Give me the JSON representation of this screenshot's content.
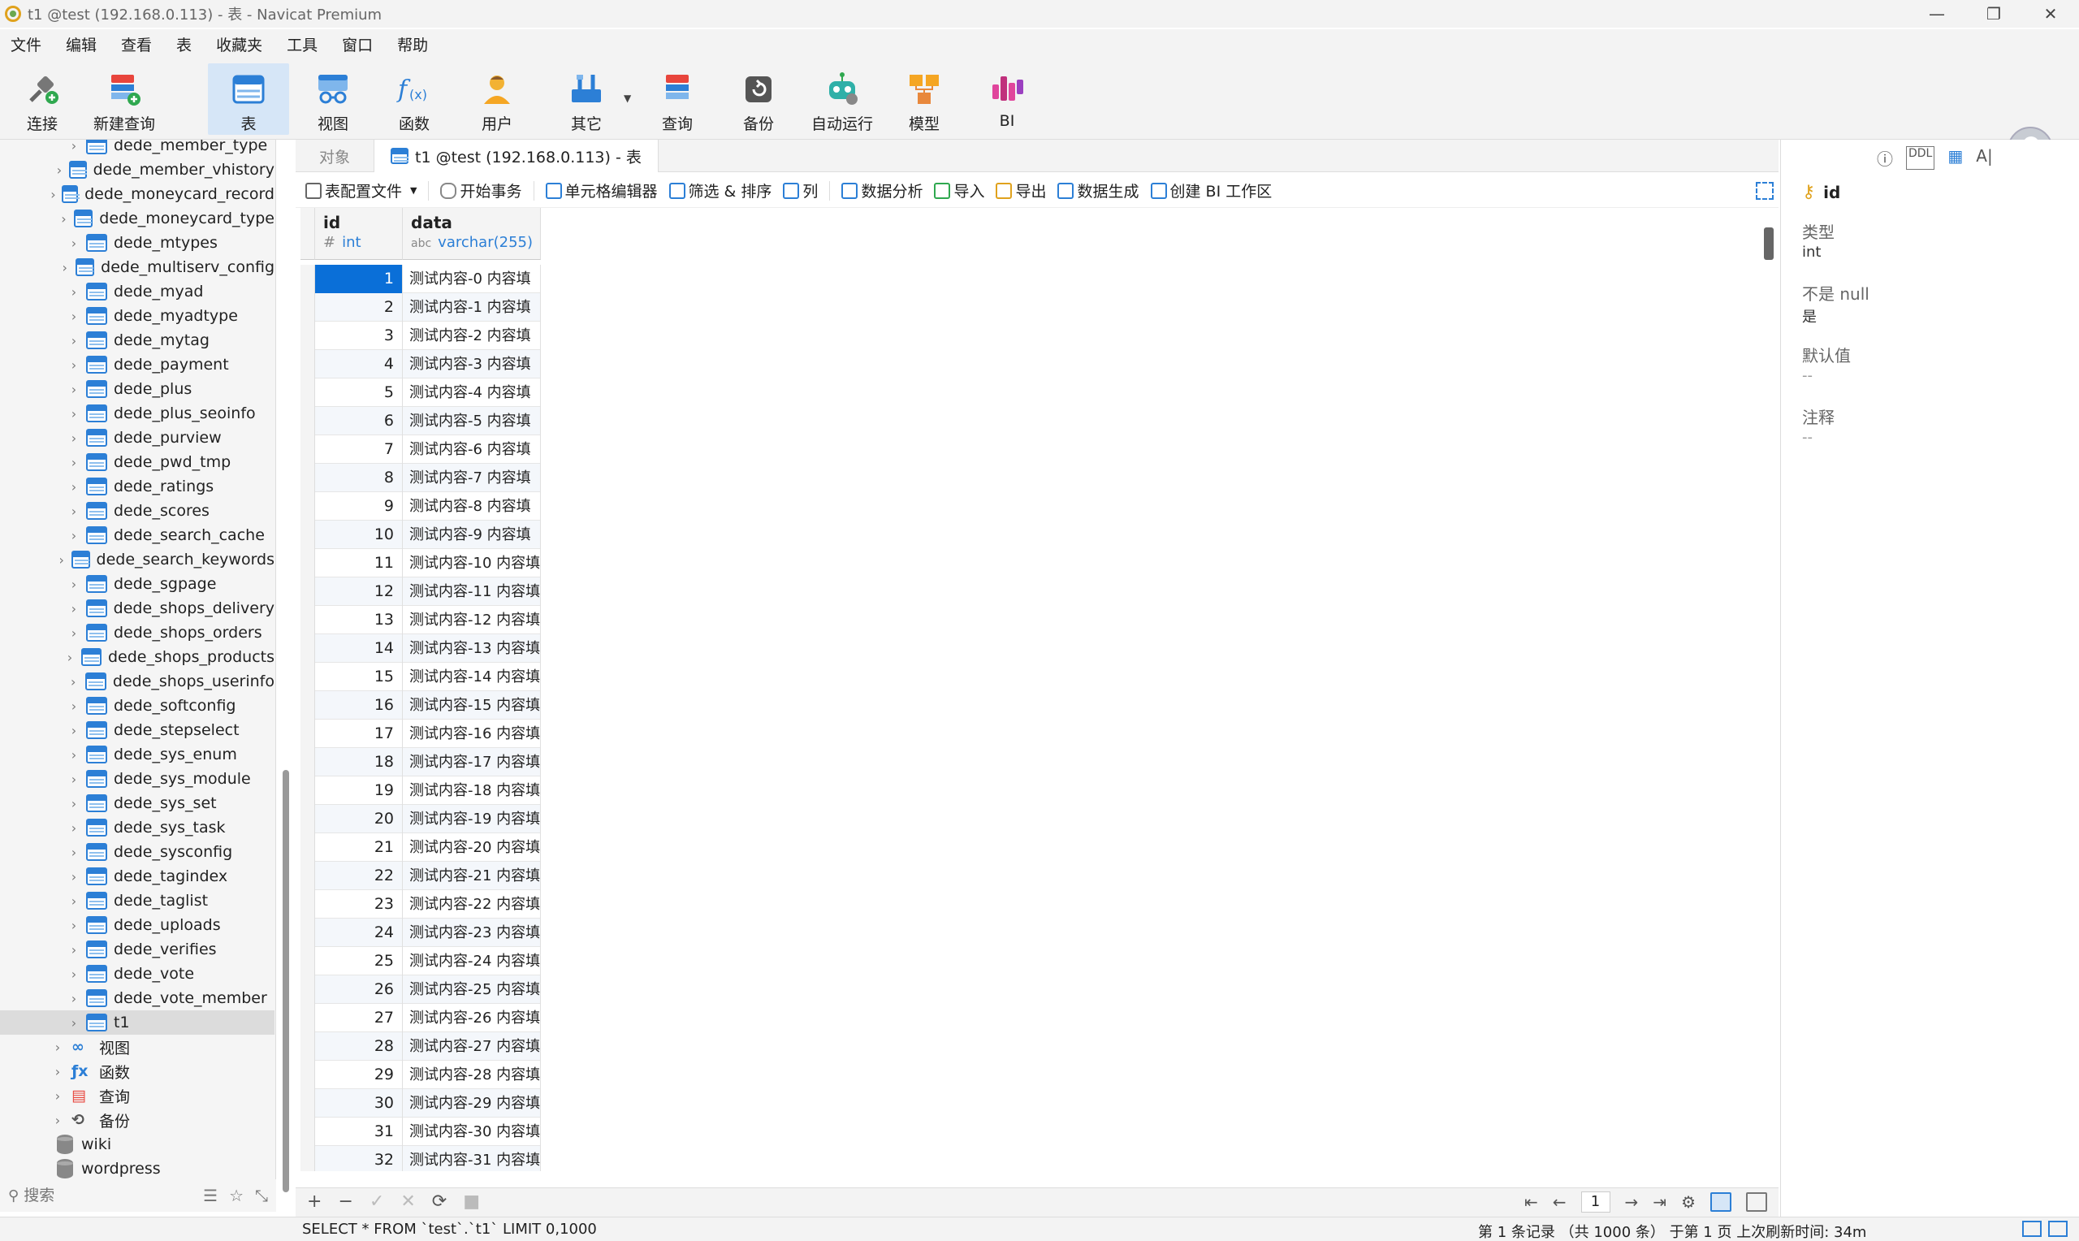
{
  "window": {
    "title": "t1 @test (192.168.0.113) - 表 - Navicat Premium",
    "controls": [
      "—",
      "❐",
      "✕"
    ]
  },
  "menu": [
    "文件",
    "编辑",
    "查看",
    "表",
    "收藏夹",
    "工具",
    "窗口",
    "帮助"
  ],
  "toolbar": {
    "connect": "连接",
    "new_query": "新建查询",
    "table": "表",
    "view": "视图",
    "function": "函数",
    "user": "用户",
    "other": "其它",
    "query": "查询",
    "backup": "备份",
    "automation": "自动运行",
    "model": "模型",
    "bi": "BI"
  },
  "sidebar": {
    "items": [
      "dede_member_type",
      "dede_member_vhistory",
      "dede_moneycard_record",
      "dede_moneycard_type",
      "dede_mtypes",
      "dede_multiserv_config",
      "dede_myad",
      "dede_myadtype",
      "dede_mytag",
      "dede_payment",
      "dede_plus",
      "dede_plus_seoinfo",
      "dede_purview",
      "dede_pwd_tmp",
      "dede_ratings",
      "dede_scores",
      "dede_search_cache",
      "dede_search_keywords",
      "dede_sgpage",
      "dede_shops_delivery",
      "dede_shops_orders",
      "dede_shops_products",
      "dede_shops_userinfo",
      "dede_softconfig",
      "dede_stepselect",
      "dede_sys_enum",
      "dede_sys_module",
      "dede_sys_set",
      "dede_sys_task",
      "dede_sysconfig",
      "dede_tagindex",
      "dede_taglist",
      "dede_uploads",
      "dede_verifies",
      "dede_vote",
      "dede_vote_member",
      "t1"
    ],
    "groups": [
      "视图",
      "函数",
      "查询",
      "备份"
    ],
    "databases": [
      "wiki",
      "wordpress"
    ],
    "search_placeholder": "搜索"
  },
  "tabs": {
    "objects": "对象",
    "active": "t1 @test (192.168.0.113) - 表"
  },
  "data_toolbar": {
    "config": "表配置文件",
    "begin_tx": "开始事务",
    "cell_editor": "单元格编辑器",
    "filter_sort": "筛选 & 排序",
    "columns": "列",
    "analysis": "数据分析",
    "import": "导入",
    "export": "导出",
    "generate": "数据生成",
    "create_bi": "创建 BI 工作区"
  },
  "grid": {
    "columns": [
      {
        "name": "id",
        "type": "int",
        "type_icon": "#"
      },
      {
        "name": "data",
        "type": "varchar(255)",
        "type_icon": "abc"
      }
    ],
    "rows": [
      [
        "1",
        "测试内容-0 内容填"
      ],
      [
        "2",
        "测试内容-1 内容填"
      ],
      [
        "3",
        "测试内容-2 内容填"
      ],
      [
        "4",
        "测试内容-3 内容填"
      ],
      [
        "5",
        "测试内容-4 内容填"
      ],
      [
        "6",
        "测试内容-5 内容填"
      ],
      [
        "7",
        "测试内容-6 内容填"
      ],
      [
        "8",
        "测试内容-7 内容填"
      ],
      [
        "9",
        "测试内容-8 内容填"
      ],
      [
        "10",
        "测试内容-9 内容填"
      ],
      [
        "11",
        "测试内容-10 内容填"
      ],
      [
        "12",
        "测试内容-11 内容填"
      ],
      [
        "13",
        "测试内容-12 内容填"
      ],
      [
        "14",
        "测试内容-13 内容填"
      ],
      [
        "15",
        "测试内容-14 内容填"
      ],
      [
        "16",
        "测试内容-15 内容填"
      ],
      [
        "17",
        "测试内容-16 内容填"
      ],
      [
        "18",
        "测试内容-17 内容填"
      ],
      [
        "19",
        "测试内容-18 内容填"
      ],
      [
        "20",
        "测试内容-19 内容填"
      ],
      [
        "21",
        "测试内容-20 内容填"
      ],
      [
        "22",
        "测试内容-21 内容填"
      ],
      [
        "23",
        "测试内容-22 内容填"
      ],
      [
        "24",
        "测试内容-23 内容填"
      ],
      [
        "25",
        "测试内容-24 内容填"
      ],
      [
        "26",
        "测试内容-25 内容填"
      ],
      [
        "27",
        "测试内容-26 内容填"
      ],
      [
        "28",
        "测试内容-27 内容填"
      ],
      [
        "29",
        "测试内容-28 内容填"
      ],
      [
        "30",
        "测试内容-29 内容填"
      ],
      [
        "31",
        "测试内容-30 内容填"
      ],
      [
        "32",
        "测试内容-31 内容填"
      ]
    ]
  },
  "nav": {
    "page": "1",
    "buttons": [
      "+",
      "−",
      "✓",
      "✕",
      "⟳",
      "■"
    ]
  },
  "status": {
    "sql": "SELECT * FROM `test`.`t1` LIMIT 0,1000",
    "info": "第 1 条记录 （共 1000 条） 于第 1 页 上次刷新时间: 34m"
  },
  "right_panel": {
    "field": "id",
    "type_label": "类型",
    "type_value": "int",
    "notnull_label": "不是 null",
    "notnull_value": "是",
    "default_label": "默认值",
    "default_value": "--",
    "comment_label": "注释",
    "comment_value": "--"
  },
  "colors": {
    "accent": "#2c7fd6",
    "selected_cell": "#0a6fd8",
    "key": "#e0a21d"
  }
}
